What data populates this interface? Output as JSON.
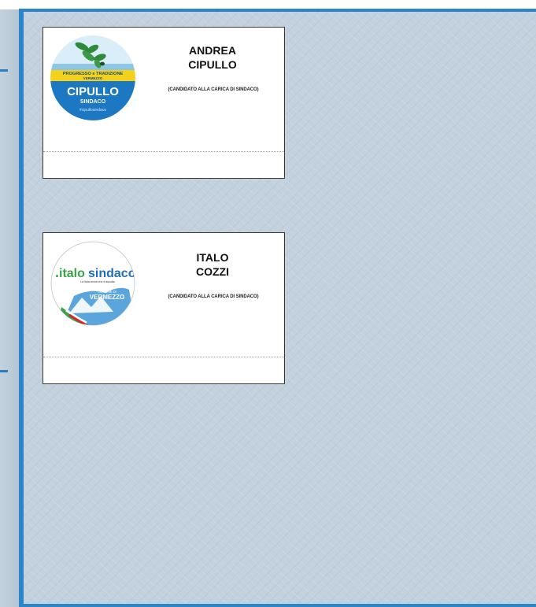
{
  "ballot": {
    "candidates": [
      {
        "first_name": "ANDREA",
        "last_name": "CIPULLO",
        "role": "(CANDIDATO ALLA CARICA DI SINDACO)",
        "logo": {
          "icon": "branch-with-leaves-icon",
          "top_line": "PROGRESSO e TRADIZIONE",
          "top_line2": "VERMEZZO",
          "name": "CIPULLO",
          "sub": "SINDACO",
          "hashtag": "#cipullosindaco",
          "colors": {
            "sky": "#cfe8f6",
            "yellow": "#f4d21a",
            "blue": "#1c78c2",
            "leaf": "#2f8a3b"
          }
        }
      },
      {
        "first_name": "ITALO",
        "last_name": "COZZI",
        "role": "(CANDIDATO ALLA CARICA DI SINDACO)",
        "logo": {
          "icon": "mountain-flag-icon",
          "dot": ".",
          "word1": "italo",
          "word2": "sindaco",
          "tagline": "La lista civica che ti ascolta",
          "town_top": "COMUNE DI",
          "town": "VERMEZZO",
          "colors": {
            "green": "#3aa34a",
            "blue": "#1f6fb8",
            "red": "#d02a2a"
          }
        }
      }
    ]
  }
}
